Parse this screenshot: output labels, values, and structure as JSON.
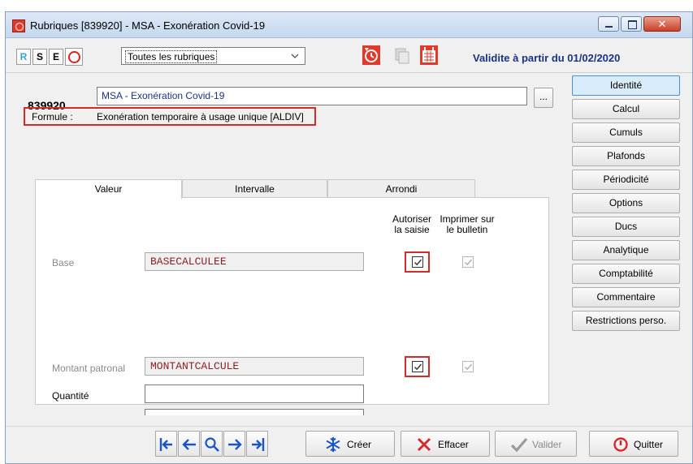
{
  "window": {
    "title": "Rubriques [839920] - MSA - Exonération Covid-19"
  },
  "toolbar": {
    "letters": [
      "R",
      "S",
      "E"
    ],
    "filter_value": "Toutes les rubriques",
    "validity": "Validite à partir du 01/02/2020"
  },
  "header": {
    "code": "839920",
    "name": "MSA - Exonération Covid-19",
    "ellipsis": "...",
    "formula_label": "Formule :",
    "formula_text": "Exonération temporaire à usage unique [ALDIV]"
  },
  "sidebar": {
    "buttons": [
      "Identité",
      "Calcul",
      "Cumuls",
      "Plafonds",
      "Périodicité",
      "Options",
      "Ducs",
      "Analytique",
      "Comptabilité",
      "Commentaire",
      "Restrictions perso."
    ],
    "active": "Identité"
  },
  "tabs": [
    "Valeur",
    "Intervalle",
    "Arrondi"
  ],
  "valeur": {
    "col_autoriser": [
      "Autoriser",
      "la saisie"
    ],
    "col_imprimer": [
      "Imprimer sur",
      "le bulletin"
    ],
    "rows": [
      {
        "label": "Base",
        "value": "BASECALCULEE",
        "autoriser": true,
        "imprimer": true
      },
      {
        "label": "Montant patronal",
        "value": "MONTANTCALCULE",
        "autoriser": true,
        "imprimer": true
      },
      {
        "label": "Quantité",
        "value": ""
      }
    ]
  },
  "buttons": {
    "creer": "Créer",
    "effacer": "Effacer",
    "valider": "Valider",
    "quitter": "Quitter"
  },
  "colors": {
    "accent_red": "#d42a2a",
    "validity_blue": "#1a3380",
    "nav_blue": "#1a55c8"
  }
}
